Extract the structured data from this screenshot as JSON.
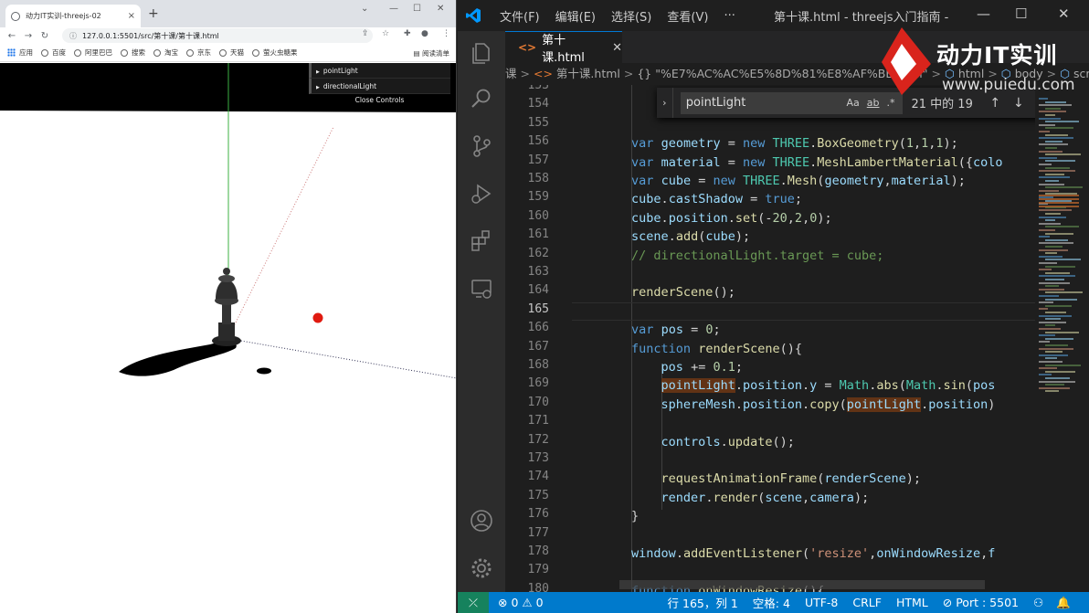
{
  "browser": {
    "tab_title": "动力IT实训-threejs-02",
    "tab_close": "×",
    "new_tab": "+",
    "url": "127.0.0.1:5501/src/第十课/第十课.html",
    "bookmarks": [
      "应用",
      "百度",
      "阿里巴巴",
      "搜索",
      "淘宝",
      "京东",
      "天猫",
      "萤火虫糖果"
    ],
    "reading_list": "阅读清单",
    "gui": {
      "folders": [
        "pointLight",
        "directionalLight"
      ],
      "close_label": "Close Controls"
    }
  },
  "vscode": {
    "menu": [
      "文件(F)",
      "编辑(E)",
      "选择(S)",
      "查看(V)",
      "···"
    ],
    "window_title": "第十课.html - threejs入门指南 -",
    "tab_label": "第十课.html",
    "breadcrumb": [
      "课",
      "第十课.html",
      "{} \"%E7%AC%AC%E5%8D%81%E8%AF%BE.html\"",
      "html",
      "body",
      "scri"
    ],
    "find": {
      "query": "pointLight",
      "options": [
        "Aa",
        "ab",
        ".*"
      ],
      "count": "21 中的 19"
    },
    "line_numbers": [
      "153",
      "154",
      "155",
      "156",
      "157",
      "158",
      "159",
      "160",
      "161",
      "162",
      "163",
      "164",
      "165",
      "166",
      "167",
      "168",
      "169",
      "170",
      "171",
      "172",
      "173",
      "174",
      "175",
      "176",
      "177",
      "178",
      "179",
      "180"
    ],
    "active_line": "165",
    "code_lines": [
      "",
      "",
      "",
      "        var geometry = new THREE.BoxGeometry(1,1,1);",
      "        var material = new THREE.MeshLambertMaterial({colo",
      "        var cube = new THREE.Mesh(geometry,material);",
      "        cube.castShadow = true;",
      "        cube.position.set(-20,2,0);",
      "        scene.add(cube);",
      "        // directionalLight.target = cube;",
      "",
      "        renderScene();",
      "",
      "        var pos = 0;",
      "        function renderScene(){",
      "            pos += 0.1;",
      "            pointLight.position.y = Math.abs(Math.sin(pos",
      "            sphereMesh.position.copy(pointLight.position)",
      "",
      "            controls.update();",
      "",
      "            requestAnimationFrame(renderScene);",
      "            render.render(scene,camera);",
      "        }",
      "",
      "        window.addEventListener('resize',onWindowResize,f",
      "",
      "        function onWindowResize(){"
    ],
    "status": {
      "errors": "0",
      "warnings": "0",
      "position": "行 165，列 1",
      "spaces": "空格: 4",
      "encoding": "UTF-8",
      "eol": "CRLF",
      "language": "HTML",
      "port": "Port : 5501"
    },
    "watermark": {
      "title": "动力IT实训",
      "url": "www.puiedu.com"
    },
    "accent": "#007acc"
  }
}
